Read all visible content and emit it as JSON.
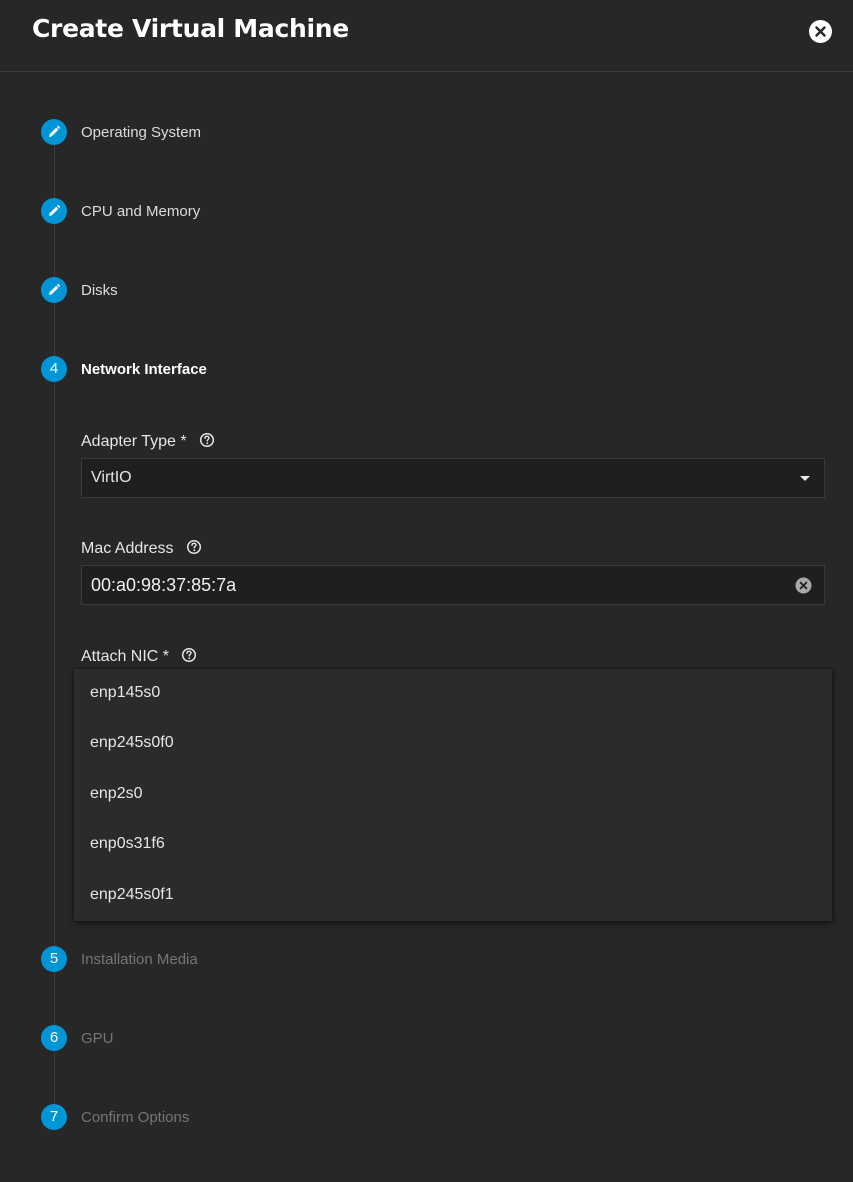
{
  "dialog": {
    "title": "Create Virtual Machine",
    "close_icon": "close-circle-icon"
  },
  "steps": [
    {
      "number": "1",
      "label": "Operating System",
      "state": "edited",
      "icon": "pencil-icon"
    },
    {
      "number": "2",
      "label": "CPU and Memory",
      "state": "edited",
      "icon": "pencil-icon"
    },
    {
      "number": "3",
      "label": "Disks",
      "state": "edited",
      "icon": "pencil-icon"
    },
    {
      "number": "4",
      "label": "Network Interface",
      "state": "active"
    },
    {
      "number": "5",
      "label": "Installation Media",
      "state": "pending"
    },
    {
      "number": "6",
      "label": "GPU",
      "state": "pending"
    },
    {
      "number": "7",
      "label": "Confirm Options",
      "state": "pending"
    }
  ],
  "network_interface": {
    "adapter_type": {
      "label": "Adapter Type *",
      "value": "VirtIO",
      "icon": "help-icon"
    },
    "mac_address": {
      "label": "Mac Address",
      "value": "00:a0:98:37:85:7a",
      "icon": "help-icon",
      "clear_icon": "clear-circle-icon"
    },
    "attach_nic": {
      "label": "Attach NIC *",
      "icon": "help-icon",
      "options": [
        "enp145s0",
        "enp245s0f0",
        "enp2s0",
        "enp0s31f6",
        "enp245s0f1"
      ]
    }
  },
  "colors": {
    "background": "#272727",
    "accent": "#0095d5",
    "field_background": "#1f1f1f",
    "dropdown_background": "#2b2b2b"
  }
}
